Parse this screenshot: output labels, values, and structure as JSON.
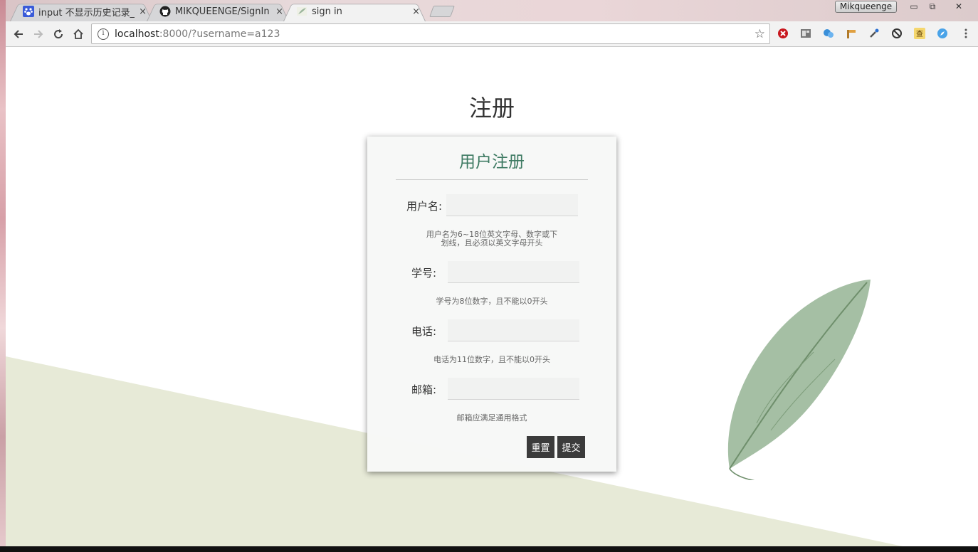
{
  "browser": {
    "tabs": [
      {
        "title": "input 不显示历史记录_百",
        "close": "×",
        "icon": "baidu-paw-icon"
      },
      {
        "title": "MIKQUEENGE/SignIn",
        "close": "×",
        "icon": "github-icon"
      },
      {
        "title": "sign in",
        "close": "×",
        "icon": "page-leaf-icon",
        "active": true
      }
    ],
    "profile_name": "Mikqueenge",
    "window_controls": {
      "minimize": "▭",
      "restore": "⧉",
      "close": "✕"
    },
    "url_host": "localhost",
    "url_rest": ":8000/?username=a123",
    "bookmark_star": "☆"
  },
  "page": {
    "title": "注册",
    "form": {
      "heading": "用户注册",
      "fields": [
        {
          "label": "用户名:",
          "value": "",
          "hint_line1": "用户名为6~18位英文字母、数字或下",
          "hint_line2": "划线，且必须以英文字母开头"
        },
        {
          "label": "学号:",
          "value": "",
          "hint_line1": "学号为8位数字，且不能以0开头"
        },
        {
          "label": "电话:",
          "value": "",
          "hint_line1": "电话为11位数字，且不能以0开头"
        },
        {
          "label": "邮箱:",
          "value": "",
          "hint_line1": "邮箱应满足通用格式"
        }
      ],
      "reset_label": "重置",
      "submit_label": "提交"
    }
  },
  "colors": {
    "accent": "#3d7a62",
    "button": "#3b3b3b",
    "leaf": "#8fb08f",
    "wedge": "#e7ead7"
  }
}
